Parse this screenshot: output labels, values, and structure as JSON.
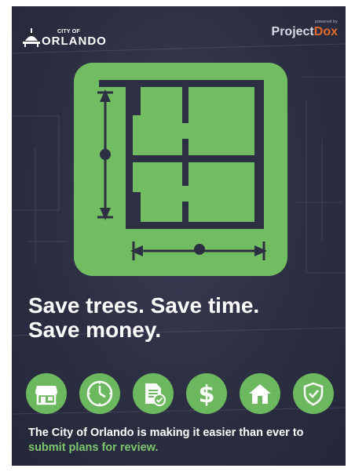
{
  "brand": {
    "city_small": "CITY OF",
    "city_big": "ORLANDO",
    "powered_by": "powered by",
    "projectdox_project": "Project",
    "projectdox_dox": "Dox"
  },
  "headline": {
    "line1": "Save trees. Save time.",
    "line2": "Save money."
  },
  "icons": [
    "storefront-icon",
    "clock-icon",
    "document-check-icon",
    "dollar-icon",
    "house-icon",
    "shield-check-icon"
  ],
  "body": {
    "text_before": "The City of Orlando is making it easier than ever to ",
    "highlight": "submit plans for review."
  },
  "colors": {
    "background": "#2c2e42",
    "accent_green": "#6cb85e",
    "highlight_green": "#7cc56c",
    "dox_orange": "#e46a2c"
  }
}
